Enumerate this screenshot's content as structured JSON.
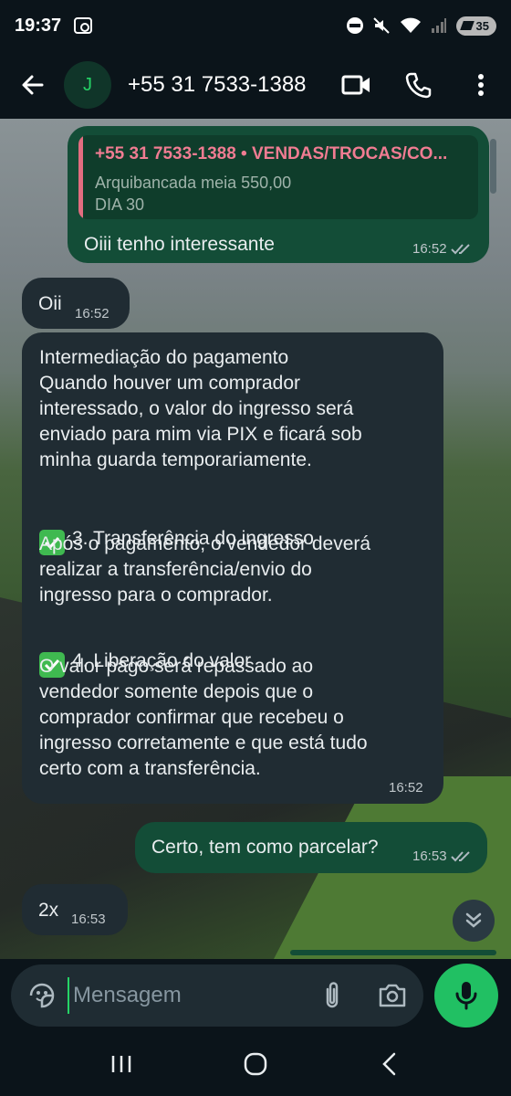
{
  "status_bar": {
    "time": "19:37",
    "battery": "35"
  },
  "header": {
    "avatar_initial": "J",
    "contact": "+55 31 7533-1388"
  },
  "messages": [
    {
      "direction": "outgoing",
      "reply": {
        "author": "+55 31 7533-1388 • VENDAS/TROCAS/CO...",
        "line1": "Arquibancada meia 550,00",
        "line2": "DIA 30"
      },
      "text": "Oiii tenho interessante",
      "time": "16:52",
      "status": "read"
    },
    {
      "direction": "incoming",
      "text": "Oii",
      "time": "16:52"
    },
    {
      "direction": "incoming",
      "para1": "Intermediação do pagamento\nQuando houver um comprador\ninteressado, o valor do ingresso será\nenviado para mim via PIX e ficará sob\nminha guarda temporariamente.",
      "heading3": "3. Transferência do ingresso",
      "para2": "Após o pagamento, o vendedor deverá\nrealizar a transferência/envio do\ningresso para o comprador.",
      "heading4": "4. Liberação do valor",
      "para3": "O valor pago será repassado ao\nvendedor somente depois que o\ncomprador confirmar que recebeu o\ningresso corretamente e que está tudo\ncerto com a transferência.",
      "time": "16:52"
    },
    {
      "direction": "outgoing",
      "text": "Certo, tem como parcelar?",
      "time": "16:53",
      "status": "read"
    },
    {
      "direction": "incoming",
      "text": "2x",
      "time": "16:53"
    }
  ],
  "composer": {
    "placeholder": "Mensagem"
  },
  "colors": {
    "accent": "#25d366",
    "outgoing_bubble": "#134d37",
    "incoming_bubble": "#202c33",
    "reply_author": "#f07c92"
  }
}
